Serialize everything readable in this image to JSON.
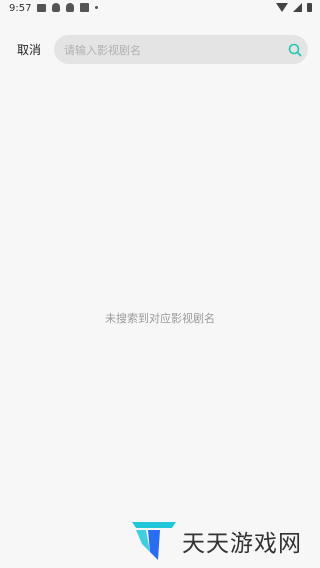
{
  "status_bar": {
    "time": "9:57",
    "left_icons": [
      "image-icon",
      "ghost-icon",
      "ghost-icon",
      "a-icon",
      "dot-icon"
    ],
    "right_icons": [
      "wifi-icon",
      "signal-icon",
      "battery-icon"
    ]
  },
  "header": {
    "cancel_label": "取消",
    "search": {
      "placeholder": "请输入影视剧名",
      "value": "",
      "icon": "search-icon",
      "icon_color": "#21c7b3"
    }
  },
  "empty_state": {
    "message": "未搜索到对应影视剧名"
  },
  "watermark": {
    "text": "天天游戏网",
    "logo_colors": [
      "#21c7d9",
      "#2a6df0"
    ]
  }
}
